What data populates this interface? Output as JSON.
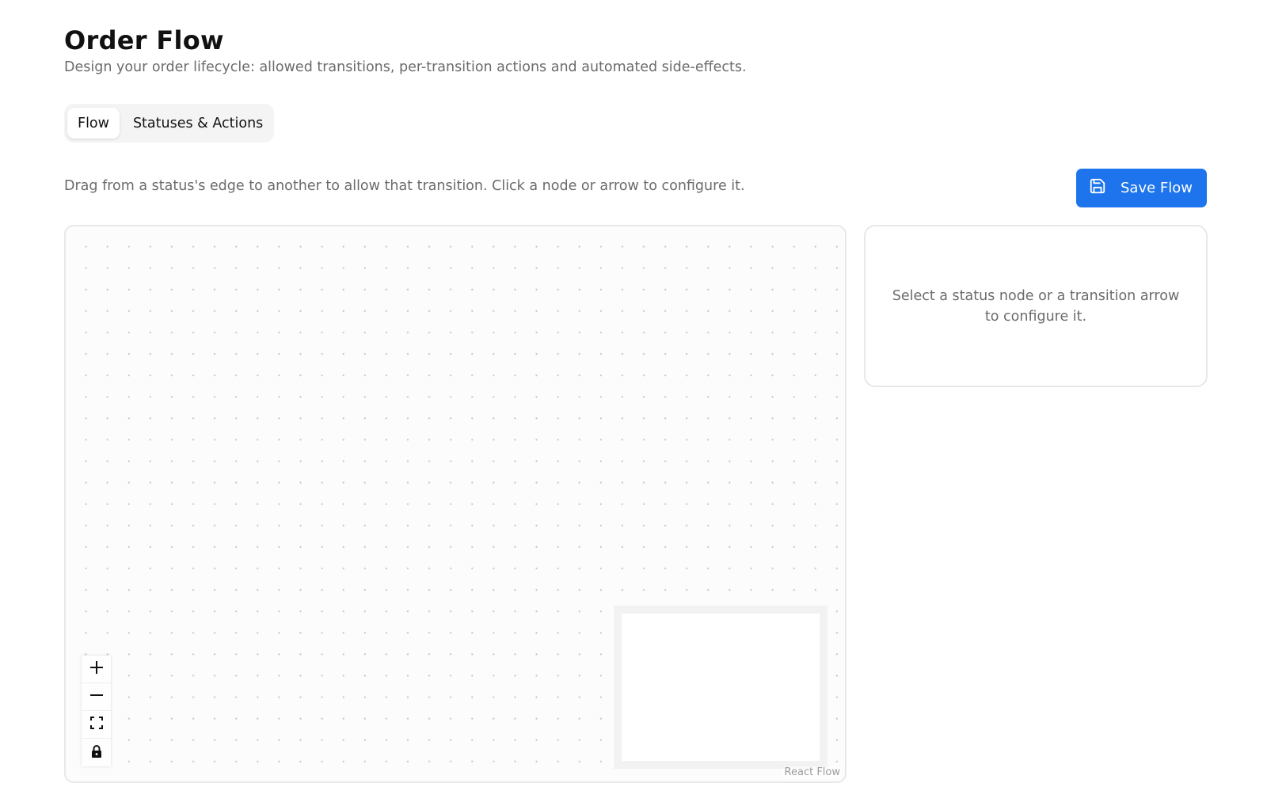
{
  "header": {
    "title": "Order Flow",
    "subtitle": "Design your order lifecycle: allowed transitions, per-transition actions and automated side-effects."
  },
  "tabs": [
    {
      "label": "Flow",
      "active": true
    },
    {
      "label": "Statuses & Actions",
      "active": false
    }
  ],
  "toolbar": {
    "instructions": "Drag from a status's edge to another to allow that transition. Click a node or arrow to configure it.",
    "save_label": "Save Flow",
    "save_icon": "save-icon"
  },
  "canvas": {
    "controls": [
      "zoom-in-icon",
      "zoom-out-icon",
      "fit-view-icon",
      "lock-icon"
    ],
    "attribution": "React Flow"
  },
  "config_panel": {
    "empty_hint": "Select a status node or a transition arrow to configure it."
  },
  "colors": {
    "primary": "#1d74ec",
    "muted_text": "#6b6b6b",
    "border": "#e8e8e8"
  }
}
